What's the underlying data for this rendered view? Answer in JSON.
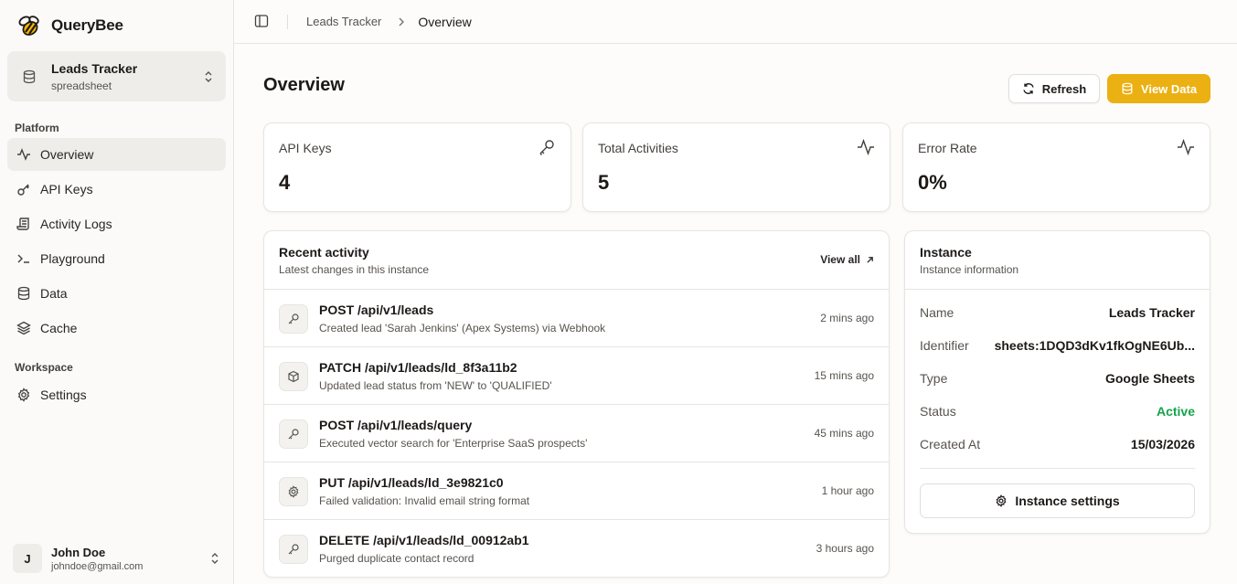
{
  "brand": {
    "name": "QueryBee"
  },
  "switcher": {
    "title": "Leads Tracker",
    "subtitle": "spreadsheet"
  },
  "sidebar": {
    "platform_label": "Platform",
    "platform_items": [
      {
        "label": "Overview",
        "icon": "activity-icon"
      },
      {
        "label": "API Keys",
        "icon": "key-icon"
      },
      {
        "label": "Activity Logs",
        "icon": "scroll-icon"
      },
      {
        "label": "Playground",
        "icon": "terminal-icon"
      },
      {
        "label": "Data",
        "icon": "database-icon"
      },
      {
        "label": "Cache",
        "icon": "layers-icon"
      }
    ],
    "workspace_label": "Workspace",
    "workspace_items": [
      {
        "label": "Settings",
        "icon": "gear-icon"
      }
    ]
  },
  "user": {
    "initial": "J",
    "name": "John Doe",
    "email": "johndoe@gmail.com"
  },
  "breadcrumb": {
    "parent": "Leads Tracker",
    "current": "Overview"
  },
  "page": {
    "title": "Overview",
    "refresh_label": "Refresh",
    "view_data_label": "View Data"
  },
  "stats": [
    {
      "label": "API Keys",
      "value": "4"
    },
    {
      "label": "Total Activities",
      "value": "5"
    },
    {
      "label": "Error Rate",
      "value": "0%"
    }
  ],
  "activity": {
    "title": "Recent activity",
    "subtitle": "Latest changes in this instance",
    "view_all": "View all",
    "items": [
      {
        "title": "POST /api/v1/leads",
        "desc": "Created lead 'Sarah Jenkins' (Apex Systems) via Webhook",
        "time": "2 mins ago",
        "icon": "key-icon"
      },
      {
        "title": "PATCH /api/v1/leads/ld_8f3a11b2",
        "desc": "Updated lead status from 'NEW' to 'QUALIFIED'",
        "time": "15 mins ago",
        "icon": "box-icon"
      },
      {
        "title": "POST /api/v1/leads/query",
        "desc": "Executed vector search for 'Enterprise SaaS prospects'",
        "time": "45 mins ago",
        "icon": "key-icon"
      },
      {
        "title": "PUT /api/v1/leads/ld_3e9821c0",
        "desc": "Failed validation: Invalid email string format",
        "time": "1 hour ago",
        "icon": "gear-icon"
      },
      {
        "title": "DELETE /api/v1/leads/ld_00912ab1",
        "desc": "Purged duplicate contact record",
        "time": "3 hours ago",
        "icon": "key-icon"
      }
    ]
  },
  "instance": {
    "title": "Instance",
    "subtitle": "Instance information",
    "fields": [
      {
        "key": "Name",
        "value": "Leads Tracker"
      },
      {
        "key": "Identifier",
        "value": "sheets:1DQD3dKv1fkOgNE6Ub..."
      },
      {
        "key": "Type",
        "value": "Google Sheets"
      },
      {
        "key": "Status",
        "value": "Active"
      },
      {
        "key": "Created At",
        "value": "15/03/2026"
      }
    ],
    "settings_label": "Instance settings"
  },
  "colors": {
    "accent": "#ebb012",
    "active_status": "#16a34a",
    "background": "#fdfcfa"
  }
}
